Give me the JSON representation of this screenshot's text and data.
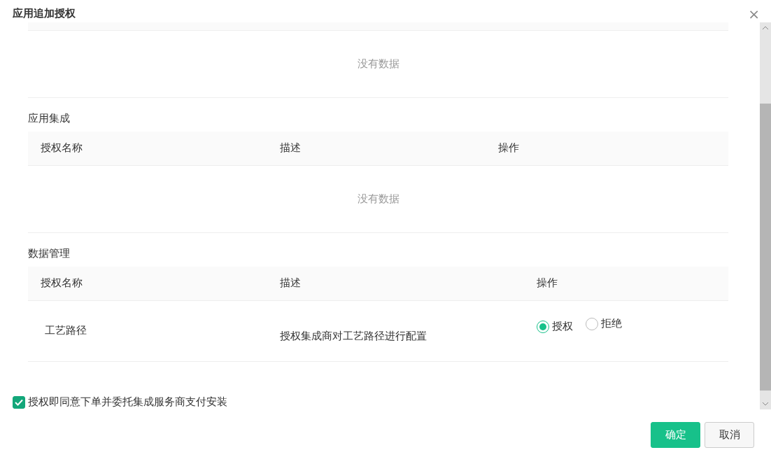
{
  "dialog": {
    "title": "应用追加授权",
    "close": "×"
  },
  "sections": [
    {
      "empty_text": "没有数据"
    },
    {
      "title": "应用集成",
      "columns": [
        "授权名称",
        "描述",
        "操作"
      ],
      "empty_text": "没有数据"
    },
    {
      "title": "数据管理",
      "columns": [
        "授权名称",
        "描述",
        "操作"
      ],
      "rows": [
        {
          "name": "工艺路径",
          "description": "授权集成商对工艺路径进行配置",
          "options": [
            {
              "label": "授权",
              "selected": true
            },
            {
              "label": "拒绝",
              "selected": false
            }
          ]
        }
      ]
    }
  ],
  "agreement": {
    "checked": true,
    "label": "授权即同意下单并委托集成服务商支付安装"
  },
  "buttons": [
    {
      "label": "确定",
      "kind": "primary"
    },
    {
      "label": "取消",
      "kind": "secondary"
    }
  ]
}
